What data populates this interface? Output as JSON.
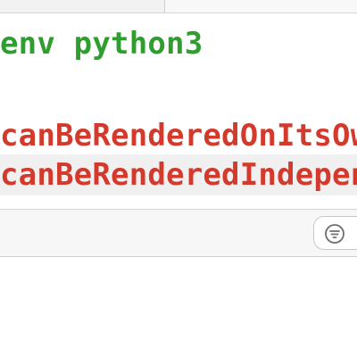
{
  "editor": {
    "lines": [
      "env python3",
      "",
      "canBeRenderedOnItsOwn",
      "canBeRenderedIndependently"
    ]
  },
  "colors": {
    "comment_green": "#2f9e2f",
    "identifier_red": "#d33a2c",
    "highlight_line": "#f0f0f0"
  },
  "icons": {
    "filter": "filter-icon"
  }
}
